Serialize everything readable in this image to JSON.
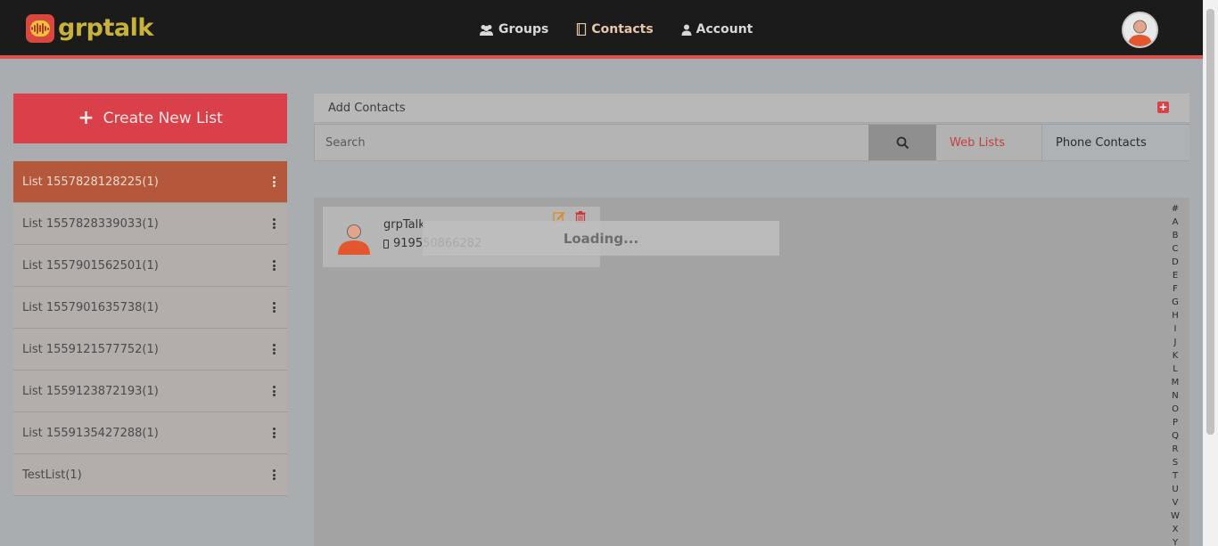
{
  "header": {
    "logo_text": "grptalk",
    "nav": [
      {
        "label": "Groups",
        "icon": "users-icon"
      },
      {
        "label": "Contacts",
        "icon": "address-book-icon"
      },
      {
        "label": "Account",
        "icon": "user-icon"
      }
    ],
    "active_nav": "Contacts"
  },
  "sidebar": {
    "create_label": "Create New List",
    "lists": [
      {
        "label": "List 1557828128225(1)",
        "active": true
      },
      {
        "label": "List 1557828339033(1)"
      },
      {
        "label": "List 1557901562501(1)"
      },
      {
        "label": "List 1557901635738(1)"
      },
      {
        "label": "List 1559121577752(1)"
      },
      {
        "label": "List 1559123872193(1)"
      },
      {
        "label": "List 1559135427288(1)"
      },
      {
        "label": "TestList(1)"
      }
    ]
  },
  "main": {
    "add_contacts_label": "Add Contacts",
    "search": {
      "placeholder": "Search"
    },
    "tabs": {
      "web_lists": "Web Lists",
      "phone_contacts": "Phone Contacts"
    },
    "contact": {
      "name": "grpTalk",
      "phone": "919550866282"
    },
    "loading_text": "Loading...",
    "alphabet": [
      "#",
      "A",
      "B",
      "C",
      "D",
      "E",
      "F",
      "G",
      "H",
      "I",
      "J",
      "K",
      "L",
      "M",
      "N",
      "O",
      "P",
      "Q",
      "R",
      "S",
      "T",
      "U",
      "V",
      "W",
      "X",
      "Y"
    ]
  },
  "colors": {
    "accent_red": "#d9404a",
    "active_list": "#b5573a",
    "topbar": "#1b1b1b",
    "logo_gold": "#c7b23a"
  }
}
